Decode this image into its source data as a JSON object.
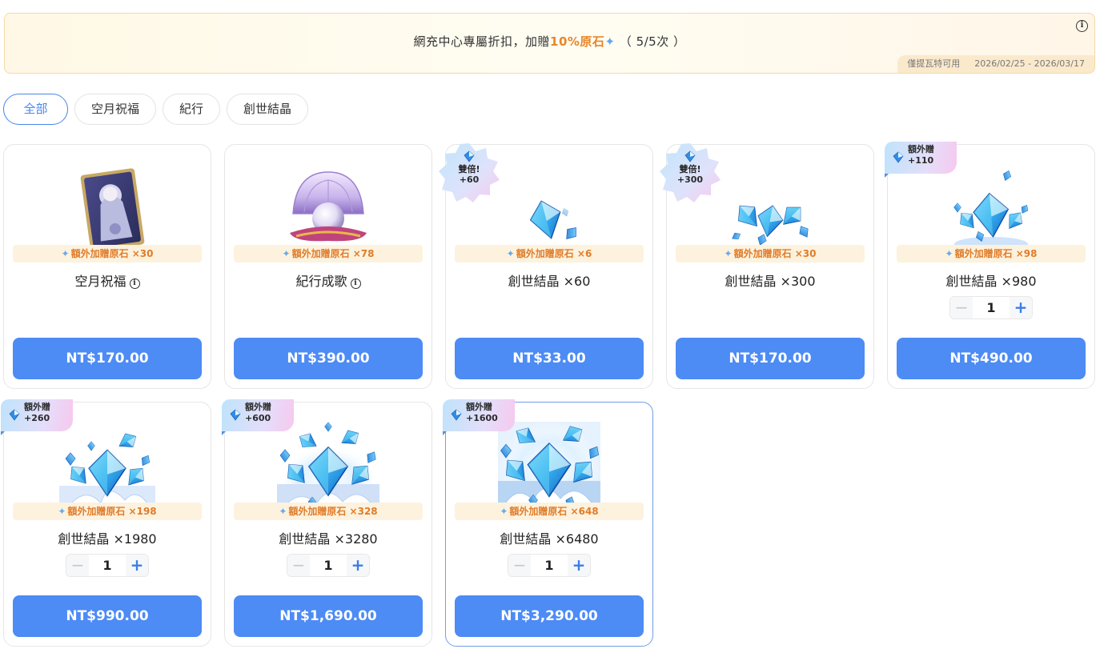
{
  "banner": {
    "text_prefix": "網充中心專屬折扣，加贈",
    "highlight": "10%原石",
    "count": "（ 5/5次 ）",
    "info_icon": "info-icon",
    "restriction": "僅提瓦特可用",
    "date_range": "2026/02/25 - 2026/03/17"
  },
  "tabs": [
    "全部",
    "空月祝福",
    "紀行",
    "創世結晶"
  ],
  "active_tab": "全部",
  "colors": {
    "accent": "#4d8bf5",
    "bonus": "#e07c2a",
    "strip": "#fdf2dd"
  },
  "products": [
    {
      "title": "空月祝福",
      "bonus": "額外加贈原石 ×30",
      "price": "NT$170.00",
      "has_info": true,
      "art": "blessing-card"
    },
    {
      "title": "紀行成歌",
      "bonus": "額外加贈原石 ×78",
      "price": "NT$390.00",
      "has_info": true,
      "art": "pearl-shell"
    },
    {
      "title": "創世結晶 ×60",
      "bonus": "額外加贈原石 ×6",
      "price": "NT$33.00",
      "badge_type": "double",
      "badge_line1": "雙倍!",
      "badge_line2": "+60",
      "art": "crystal-s"
    },
    {
      "title": "創世結晶 ×300",
      "bonus": "額外加贈原石 ×30",
      "price": "NT$170.00",
      "badge_type": "double",
      "badge_line1": "雙倍!",
      "badge_line2": "+300",
      "art": "crystal-m"
    },
    {
      "title": "創世結晶 ×980",
      "bonus": "額外加贈原石 ×98",
      "price": "NT$490.00",
      "badge_type": "extra",
      "badge_line1": "額外贈",
      "badge_line2": "+110",
      "qty": "1",
      "art": "crystal-l"
    },
    {
      "title": "創世結晶 ×1980",
      "bonus": "額外加贈原石 ×198",
      "price": "NT$990.00",
      "badge_type": "extra",
      "badge_line1": "額外贈",
      "badge_line2": "+260",
      "qty": "1",
      "art": "crystal-xl"
    },
    {
      "title": "創世結晶 ×3280",
      "bonus": "額外加贈原石 ×328",
      "price": "NT$1,690.00",
      "badge_type": "extra",
      "badge_line1": "額外贈",
      "badge_line2": "+600",
      "qty": "1",
      "art": "crystal-xxl"
    },
    {
      "title": "創世結晶 ×6480",
      "bonus": "額外加贈原石 ×648",
      "price": "NT$3,290.00",
      "badge_type": "extra",
      "badge_line1": "額外贈",
      "badge_line2": "+1600",
      "qty": "1",
      "art": "crystal-max"
    }
  ]
}
